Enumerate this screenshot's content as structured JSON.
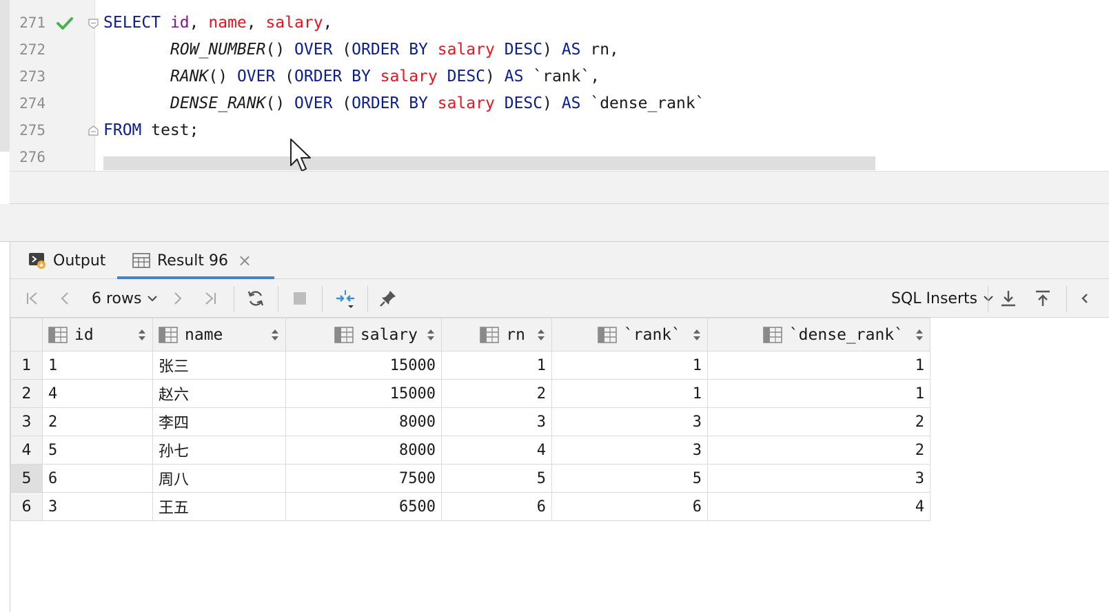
{
  "editor": {
    "line_numbers": [
      "271",
      "272",
      "273",
      "274",
      "275",
      "276"
    ],
    "code": {
      "l271": {
        "kw1": "SELECT",
        "c1": "id",
        "p1": ", ",
        "c2": "name",
        "p2": ", ",
        "c3": "salary",
        "p3": ","
      },
      "l272": {
        "fn": "ROW_NUMBER",
        "p1": "() ",
        "kw1": "OVER",
        "p2": " (",
        "kw2": "ORDER BY",
        "p3": " ",
        "col": "salary",
        "p4": " ",
        "kw3": "DESC",
        "p5": ") ",
        "kw4": "AS",
        "alias": " rn,"
      },
      "l273": {
        "fn": "RANK",
        "p1": "() ",
        "kw1": "OVER",
        "p2": " (",
        "kw2": "ORDER BY",
        "p3": " ",
        "col": "salary",
        "p4": " ",
        "kw3": "DESC",
        "p5": ") ",
        "kw4": "AS",
        "alias": " `rank`,"
      },
      "l274": {
        "fn": "DENSE_RANK",
        "p1": "() ",
        "kw1": "OVER",
        "p2": " (",
        "kw2": "ORDER BY",
        "p3": " ",
        "col": "salary",
        "p4": " ",
        "kw3": "DESC",
        "p5": ") ",
        "kw4": "AS",
        "alias": " `dense_rank`"
      },
      "l275": {
        "kw1": "FROM",
        "rest": " test;"
      }
    }
  },
  "tabs": {
    "output_label": "Output",
    "result_label": "Result 96"
  },
  "toolbar": {
    "rows_label": "6 rows",
    "export_label": "SQL Inserts"
  },
  "grid": {
    "columns": [
      "id",
      "name",
      "salary",
      "rn",
      "`rank`",
      "`dense_rank`"
    ],
    "rows": [
      {
        "no": "1",
        "id": "1",
        "name": "张三",
        "salary": "15000",
        "rn": "1",
        "rank": "1",
        "dense_rank": "1"
      },
      {
        "no": "2",
        "id": "4",
        "name": "赵六",
        "salary": "15000",
        "rn": "2",
        "rank": "1",
        "dense_rank": "1"
      },
      {
        "no": "3",
        "id": "2",
        "name": "李四",
        "salary": "8000",
        "rn": "3",
        "rank": "3",
        "dense_rank": "2"
      },
      {
        "no": "4",
        "id": "5",
        "name": "孙七",
        "salary": "8000",
        "rn": "4",
        "rank": "3",
        "dense_rank": "2"
      },
      {
        "no": "5",
        "id": "6",
        "name": "周八",
        "salary": "7500",
        "rn": "5",
        "rank": "5",
        "dense_rank": "3"
      },
      {
        "no": "6",
        "id": "3",
        "name": "王五",
        "salary": "6500",
        "rn": "6",
        "rank": "6",
        "dense_rank": "4"
      }
    ]
  },
  "colors": {
    "keyword": "#0a1f8f",
    "column": "#e8141e",
    "accent": "#4083c9",
    "check": "#4caf50"
  }
}
